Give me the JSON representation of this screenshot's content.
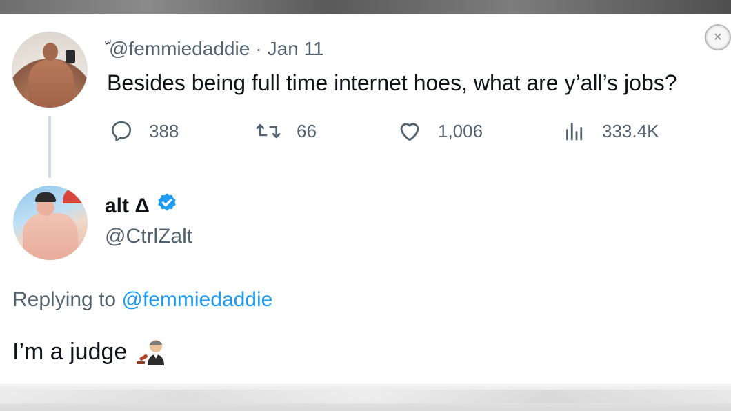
{
  "tweet1": {
    "name_glyph": "ّ",
    "handle": "@femmiedaddie",
    "separator": "·",
    "date": "Jan 11",
    "text": "Besides being full time internet hoes, what are y’all’s jobs?",
    "stats": {
      "replies": "388",
      "retweets": "66",
      "likes": "1,006",
      "views": "333.4K"
    }
  },
  "tweet2": {
    "name": "alt Δ",
    "handle": "@CtrlZalt",
    "verified": true,
    "replying_prefix": "Replying to",
    "replying_to": "@femmiedaddie",
    "text": "I’m a judge",
    "emoji": "judge"
  },
  "icons": {
    "reply": "reply-icon",
    "retweet": "retweet-icon",
    "like": "heart-icon",
    "views": "views-icon",
    "close": "close-icon",
    "verified": "verified-badge-icon"
  },
  "colors": {
    "text": "#0f1419",
    "secondary": "#536471",
    "accent": "#1d9bf0",
    "thread_line": "#cfd9de"
  }
}
